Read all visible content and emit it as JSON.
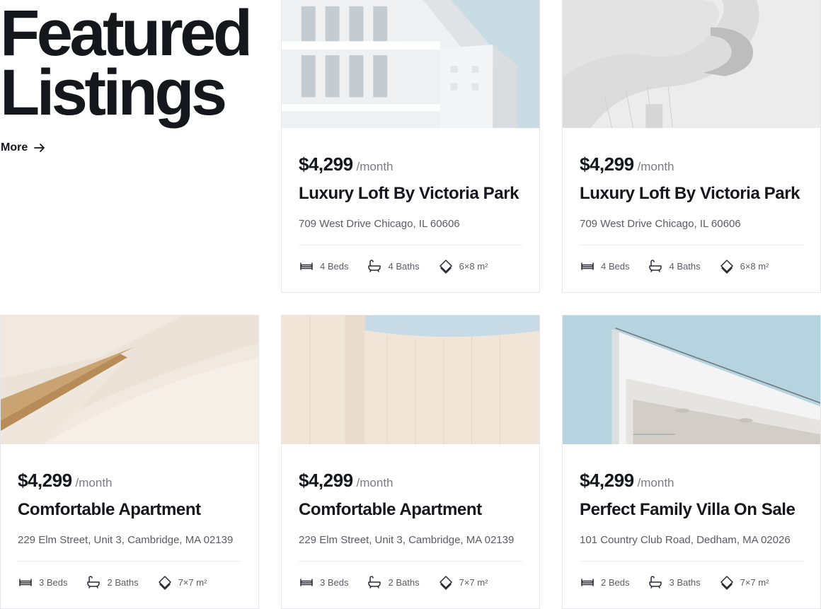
{
  "hero": {
    "title_line1": "Featured",
    "title_line2": "Listings",
    "more_label": "More"
  },
  "listings": [
    {
      "price": "$4,299",
      "period": "/month",
      "title": "Luxury Loft By Victoria Park",
      "address": "709 West Drive Chicago, IL 60606",
      "beds": "4 Beds",
      "baths": "4 Baths",
      "area": "6×8 m²"
    },
    {
      "price": "$4,299",
      "period": "/month",
      "title": "Luxury Loft By Victoria Park",
      "address": "709 West Drive Chicago, IL 60606",
      "beds": "4 Beds",
      "baths": "4 Baths",
      "area": "6×8 m²"
    },
    {
      "price": "$4,299",
      "period": "/month",
      "title": "Comfortable Apartment",
      "address": "229 Elm Street, Unit 3, Cambridge, MA 02139",
      "beds": "3 Beds",
      "baths": "2 Baths",
      "area": "7×7 m²"
    },
    {
      "price": "$4,299",
      "period": "/month",
      "title": "Comfortable Apartment",
      "address": "229 Elm Street, Unit 3, Cambridge, MA 02139",
      "beds": "3 Beds",
      "baths": "2 Baths",
      "area": "7×7 m²"
    },
    {
      "price": "$4,299",
      "period": "/month",
      "title": "Perfect Family Villa On Sale",
      "address": "101 Country Club Road, Dedham, MA 02026",
      "beds": "2 Beds",
      "baths": "3 Baths",
      "area": "7×7 m²"
    }
  ],
  "icons": {
    "more": "arrow-right-icon",
    "beds": "bed-icon",
    "baths": "bathtub-icon",
    "area": "area-icon"
  },
  "colors": {
    "text": "#16161d",
    "muted": "#5b5b66",
    "border": "#e6e6eb"
  }
}
